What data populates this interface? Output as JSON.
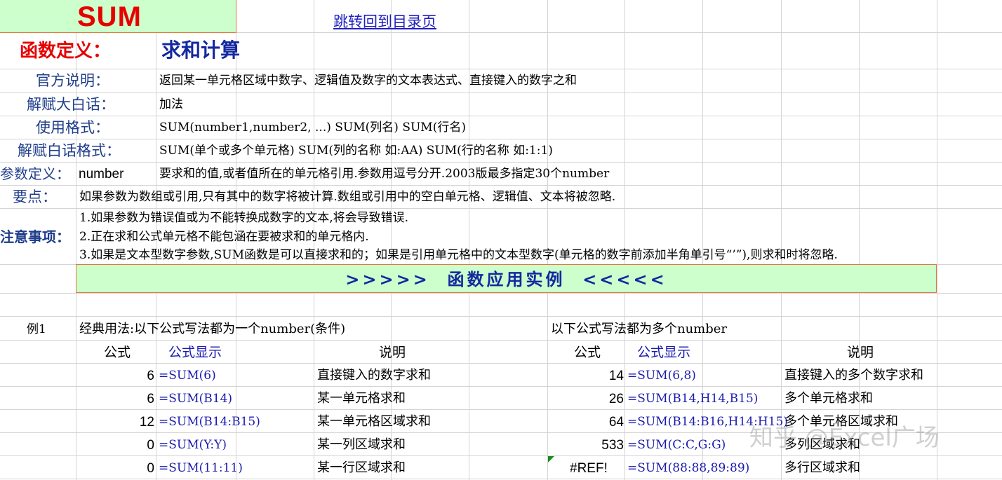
{
  "header": {
    "title": "SUM",
    "link_text": "跳转回到目录页"
  },
  "definition": {
    "label": "函数定义：",
    "value": "求和计算"
  },
  "info_rows": [
    {
      "label": "官方说明：",
      "text": "返回某一单元格区域中数字、逻辑值及数字的文本表达式、直接键入的数字之和"
    },
    {
      "label": "解赋大白话：",
      "text": "加法"
    },
    {
      "label": "使用格式：",
      "text": "SUM(number1,number2, ...) SUM(列名)  SUM(行名)"
    },
    {
      "label": "解赋白话格式：",
      "text": "SUM(单个或多个单元格)   SUM(列的名称 如:AA)   SUM(行的名称 如:1:1)"
    }
  ],
  "params": {
    "label": "参数定义：",
    "name": "number",
    "text": "要求和的值,或者值所在的单元格引用.参数用逗号分开.2003版最多指定30个number"
  },
  "keypoint": {
    "label": "要点：",
    "text": "如果参数为数组或引用,只有其中的数字将被计算.数组或引用中的空白单元格、逻辑值、文本将被忽略."
  },
  "notes": {
    "label": "注意事项：",
    "lines": [
      "1.如果参数为错误值或为不能转换成数字的文本,将会导致错误.",
      "2.正在求和公式单元格不能包涵在要被求和的单元格内.",
      "3.如果是文本型数字参数,SUM函数是可以直接求和的；如果是引用单元格中的文本型数字(单元格的数字前添加半角单引号“’”),则求和时将忽略."
    ]
  },
  "banner": {
    "text": ">>>>>  函数应用实例  <<<<<"
  },
  "example": {
    "label": "例1",
    "left_title": "经典用法:以下公式写法都为一个number(条件)",
    "right_title": "以下公式写法都为多个number",
    "headers": {
      "result": "公式",
      "formula": "公式显示",
      "desc": "说明"
    },
    "left_rows": [
      {
        "result": "6",
        "formula": "=SUM(6)",
        "desc": "直接键入的数字求和"
      },
      {
        "result": "6",
        "formula": "=SUM(B14)",
        "desc": "某一单元格求和"
      },
      {
        "result": "12",
        "formula": "=SUM(B14:B15)",
        "desc": "某一单元格区域求和"
      },
      {
        "result": "0",
        "formula": "=SUM(Y:Y)",
        "desc": "某一列区域求和"
      },
      {
        "result": "0",
        "formula": "=SUM(11:11)",
        "desc": "某一行区域求和"
      }
    ],
    "right_rows": [
      {
        "result": "14",
        "formula": "=SUM(6,8)",
        "desc": "直接键入的多个数字求和"
      },
      {
        "result": "26",
        "formula": "=SUM(B14,H14,B15)",
        "desc": "多个单元格求和"
      },
      {
        "result": "64",
        "formula": "=SUM(B14:B16,H14:H15)",
        "desc": "多个单元格区域求和"
      },
      {
        "result": "533",
        "formula": "=SUM(C:C,G:G)",
        "desc": "多列区域求和"
      },
      {
        "result": "#REF!",
        "formula": "=SUM(88:88,89:89)",
        "desc": "多行区域求和"
      }
    ]
  },
  "watermark": "知乎 @Excel广场",
  "colors": {
    "title_red": "#e60000",
    "title_fill": "#ccffcc",
    "banner_fill": "#ccffcc",
    "label_blue": "#1f3d8a",
    "definition_blue": "#1428a0",
    "link_blue": "#2020c0",
    "formula_blue": "#1a1ab0",
    "grid": "#d4d4d4",
    "banner_border": "#e07b39",
    "error_marker": "#1a8a1a"
  }
}
